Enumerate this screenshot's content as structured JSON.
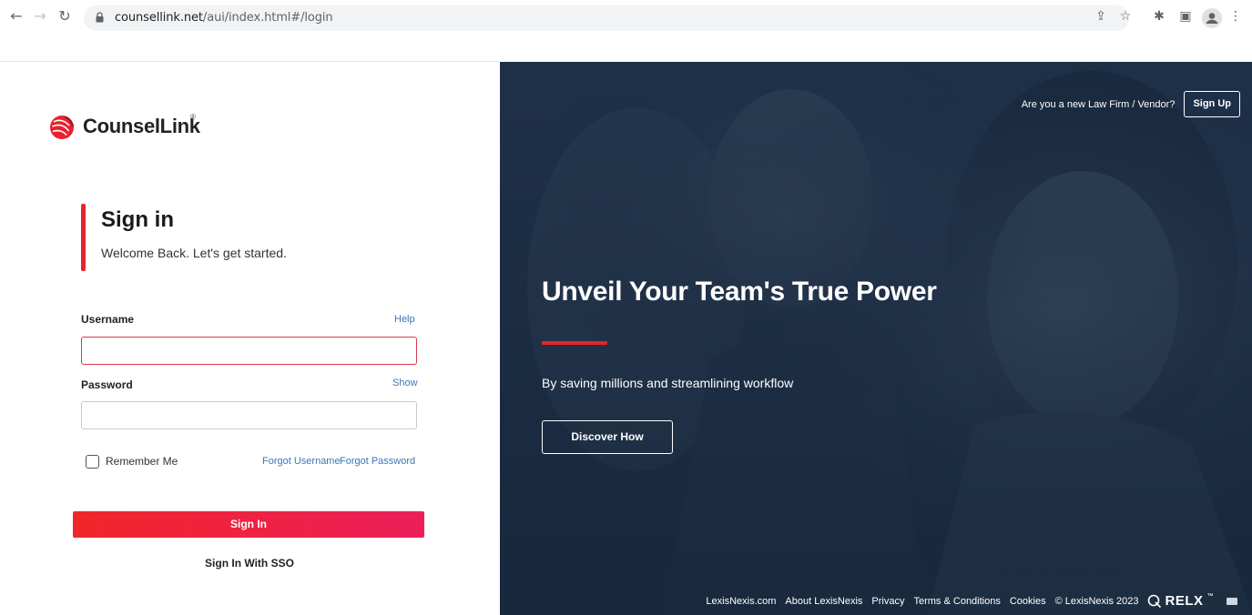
{
  "browser": {
    "url_host": "counsellink.net",
    "url_path": "/aui/index.html#/login"
  },
  "left": {
    "logo_text": "CounselLink",
    "logo_reg": "®",
    "title": "Sign in",
    "subtitle": "Welcome Back. Let's get started.",
    "username": {
      "label": "Username",
      "help": "Help",
      "value": "",
      "placeholder": ""
    },
    "password": {
      "label": "Password",
      "show": "Show",
      "value": "",
      "placeholder": ""
    },
    "remember_label": "Remember Me",
    "forgot_username": "Forgot Username",
    "forgot_password": "Forgot Password",
    "signin_button": "Sign In",
    "sso": "Sign In With SSO"
  },
  "hero": {
    "new_firm_text": "Are you a new Law Firm / Vendor?",
    "signup_button": "Sign Up",
    "title": "Unveil Your Team's True Power",
    "subtitle": "By saving millions and streamlining workflow",
    "discover_button": "Discover How",
    "footer": {
      "links": [
        "LexisNexis.com",
        "About LexisNexis",
        "Privacy",
        "Terms & Conditions",
        "Cookies"
      ],
      "copyright": "© LexisNexis 2023",
      "relx": "RELX",
      "tm": "™"
    }
  },
  "colors": {
    "accent": "#e8232f",
    "gradient_end": "#ec1f5a",
    "link": "#3a77b7",
    "hero_bg": "#1d3049"
  },
  "icons": [
    "back-arrow-icon",
    "forward-arrow-icon",
    "reload-icon",
    "lock-icon",
    "share-icon",
    "star-icon",
    "extensions-icon",
    "side-panel-icon",
    "profile-icon",
    "kebab-menu-icon",
    "counsellink-logo-icon",
    "relx-logo-icon",
    "flag-icon"
  ]
}
